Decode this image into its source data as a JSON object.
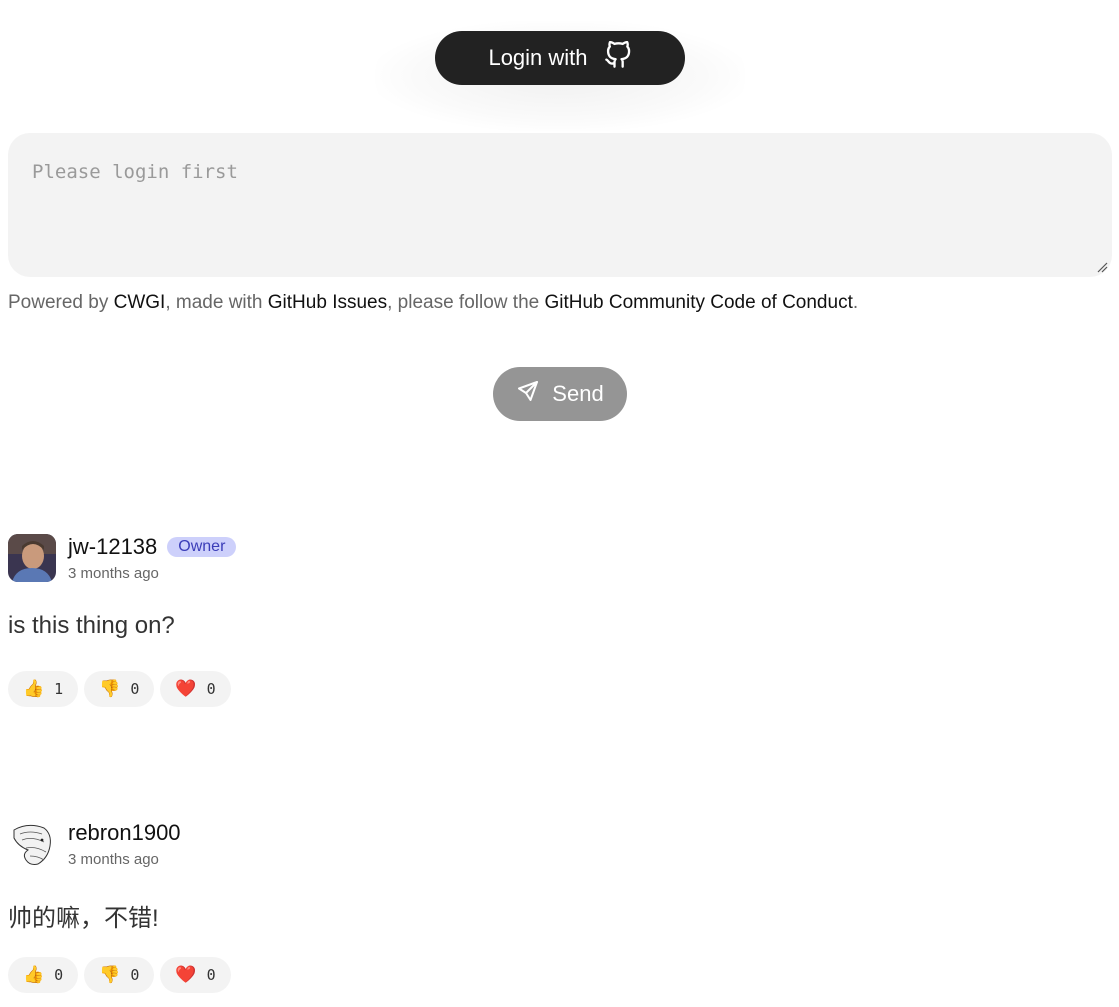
{
  "login": {
    "label": "Login with",
    "icon": "github-icon"
  },
  "editor": {
    "placeholder": "Please login first"
  },
  "powered": {
    "prefix": "Powered by ",
    "link1": "CWGI",
    "mid1": ", made with ",
    "link2": "GitHub Issues",
    "mid2": ", please follow the ",
    "link3": "GitHub Community Code of Conduct",
    "suffix": "."
  },
  "send": {
    "label": "Send",
    "icon": "send-icon"
  },
  "comments": [
    {
      "author": "jw-12138",
      "badge": "Owner",
      "time": "3 months ago",
      "body": "is this thing on?",
      "reactions": [
        {
          "emoji": "👍",
          "icon": "thumbs-up-icon",
          "count": "1"
        },
        {
          "emoji": "👎",
          "icon": "thumbs-down-icon",
          "count": "0"
        },
        {
          "emoji": "❤️",
          "icon": "heart-icon",
          "count": "0"
        }
      ]
    },
    {
      "author": "rebron1900",
      "time": "3 months ago",
      "body": "帅的嘛，不错!",
      "reactions": [
        {
          "emoji": "👍",
          "icon": "thumbs-up-icon",
          "count": "0"
        },
        {
          "emoji": "👎",
          "icon": "thumbs-down-icon",
          "count": "0"
        },
        {
          "emoji": "❤️",
          "icon": "heart-icon",
          "count": "0"
        }
      ]
    }
  ]
}
